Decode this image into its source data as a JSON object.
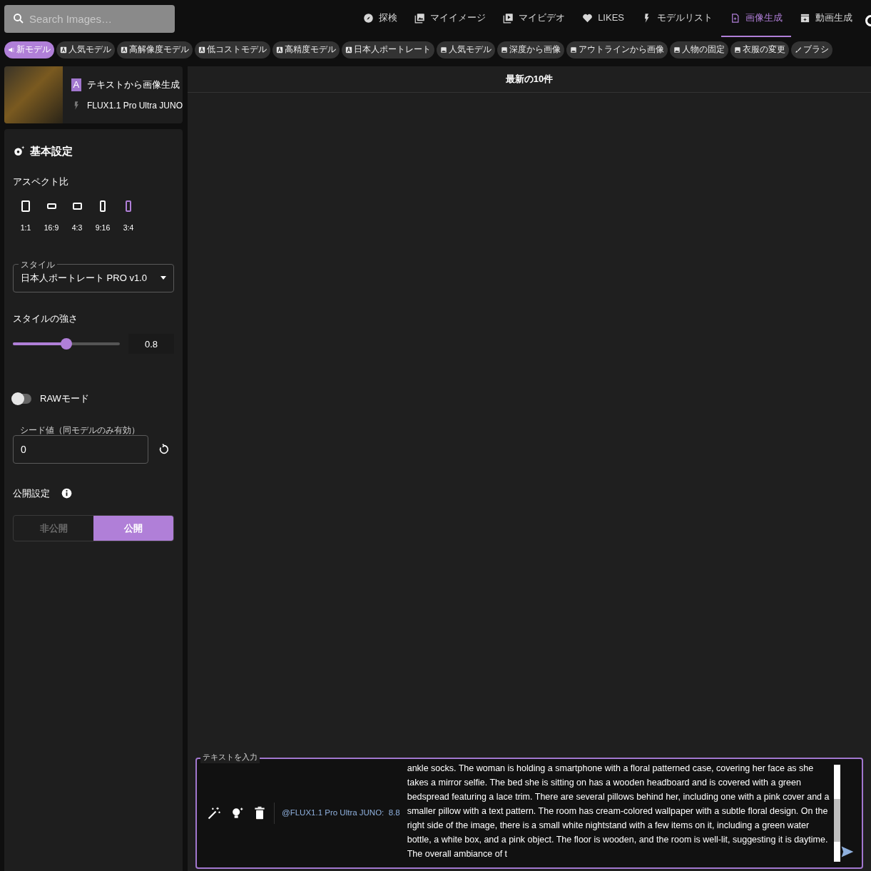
{
  "search": {
    "placeholder": "Search Images…"
  },
  "nav_tabs": [
    {
      "label": "探検",
      "selected": false
    },
    {
      "label": "マイイメージ",
      "selected": false
    },
    {
      "label": "マイビデオ",
      "selected": false
    },
    {
      "label": "LIKES",
      "selected": false
    },
    {
      "label": "モデルリスト",
      "selected": false
    },
    {
      "label": "画像生成",
      "selected": true
    },
    {
      "label": "動画生成",
      "selected": false
    }
  ],
  "chips": [
    {
      "label": "新モデル",
      "kind": "new",
      "selected": true
    },
    {
      "label": "人気モデル",
      "kind": "text",
      "selected": false
    },
    {
      "label": "高解像度モデル",
      "kind": "text",
      "selected": false
    },
    {
      "label": "低コストモデル",
      "kind": "text",
      "selected": false
    },
    {
      "label": "高精度モデル",
      "kind": "text",
      "selected": false
    },
    {
      "label": "日本人ポートレート",
      "kind": "text",
      "selected": false
    },
    {
      "label": "人気モデル",
      "kind": "image",
      "selected": false
    },
    {
      "label": "深度から画像",
      "kind": "image",
      "selected": false
    },
    {
      "label": "アウトラインから画像",
      "kind": "image",
      "selected": false
    },
    {
      "label": "人物の固定",
      "kind": "image",
      "selected": false
    },
    {
      "label": "衣服の変更",
      "kind": "image",
      "selected": false
    },
    {
      "label": "ブラシ",
      "kind": "brush",
      "selected": false
    }
  ],
  "model_card": {
    "badge": "A",
    "title": "テキストから画像生成",
    "model": "FLUX1.1 Pro Ultra JUNO"
  },
  "settings": {
    "title": "基本設定",
    "aspect_label": "アスペクト比",
    "aspects": [
      {
        "label": "1:1",
        "selected": false
      },
      {
        "label": "16:9",
        "selected": false
      },
      {
        "label": "4:3",
        "selected": false
      },
      {
        "label": "9:16",
        "selected": false
      },
      {
        "label": "3:4",
        "selected": true
      }
    ],
    "style": {
      "label": "スタイル",
      "value": "日本人ポートレート PRO v1.0"
    },
    "strength": {
      "label": "スタイルの強さ",
      "level": 0.5,
      "reading": "0.8"
    },
    "raw_mode": {
      "label": "RAWモード",
      "on": false
    },
    "seed": {
      "label": "シード値（同モデルのみ有効）",
      "value": "0"
    },
    "visibility": {
      "label": "公開設定",
      "options": [
        {
          "label": "非公開",
          "selected": false
        },
        {
          "label": "公開",
          "selected": true
        }
      ]
    }
  },
  "results": {
    "title": "最新の10件"
  },
  "prompt": {
    "legend": "テキストを入力",
    "model_score": "@FLUX1.1 Pro Ultra JUNO:  8.8",
    "value": "ankle socks. The woman is holding a smartphone with a floral patterned case, covering her face as she takes a mirror selfie. The bed she is sitting on has a wooden headboard and is covered with a green bedspread featuring a lace trim. There are several pillows behind her, including one with a pink cover and a smaller pillow with a text pattern. The room has cream-colored wallpaper with a subtle floral design. On the right side of the image, there is a small white nightstand with a few items on it, including a green water bottle, a white box, and a pink object. The floor is wooden, and the room is well-lit, suggesting it is daytime. The overall ambiance of t"
  }
}
